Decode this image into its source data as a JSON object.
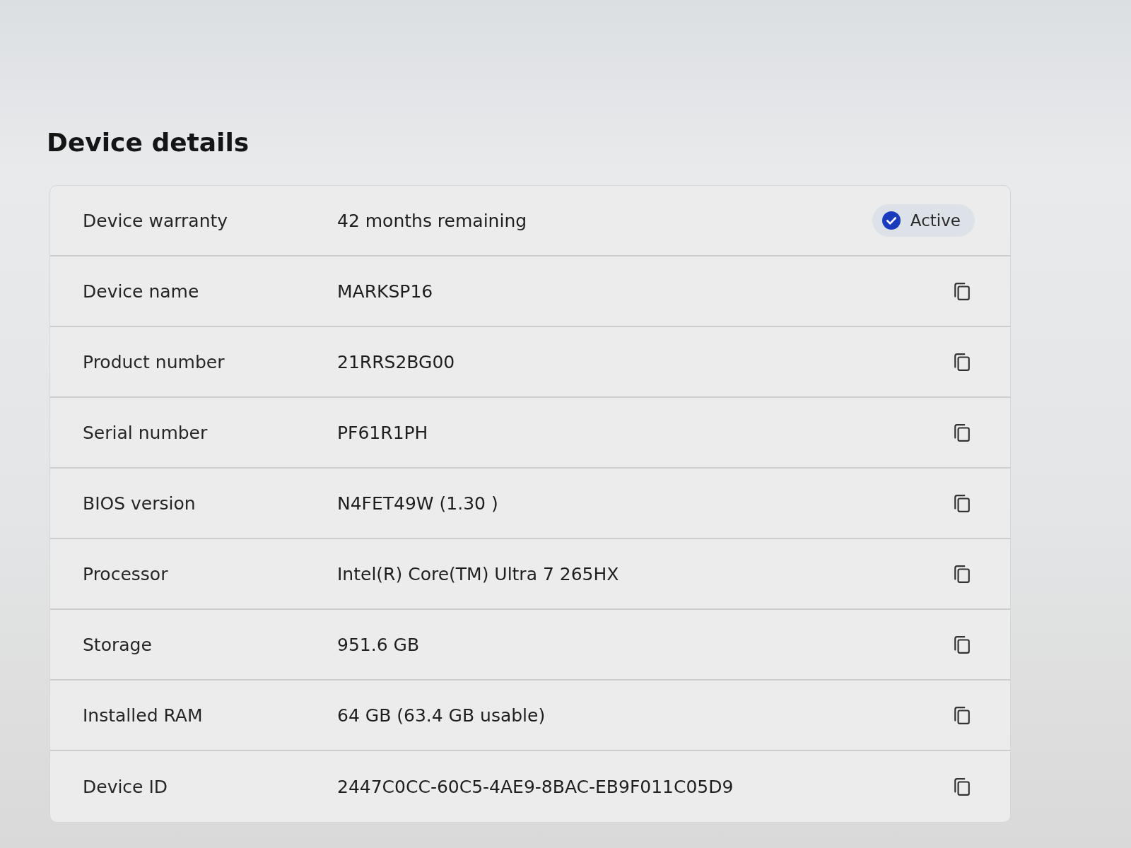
{
  "heading": "Device details",
  "rows": [
    {
      "kind": "status",
      "label": "Device warranty",
      "value": "42 months remaining",
      "badge": "Active"
    },
    {
      "kind": "copy",
      "label": "Device name",
      "value": "MARKSP16"
    },
    {
      "kind": "copy",
      "label": "Product number",
      "value": "21RRS2BG00"
    },
    {
      "kind": "copy",
      "label": "Serial number",
      "value": "PF61R1PH"
    },
    {
      "kind": "copy",
      "label": "BIOS version",
      "value": "N4FET49W (1.30 )"
    },
    {
      "kind": "copy",
      "label": "Processor",
      "value": "Intel(R) Core(TM) Ultra 7 265HX"
    },
    {
      "kind": "copy",
      "label": "Storage",
      "value": "951.6 GB"
    },
    {
      "kind": "copy",
      "label": "Installed RAM",
      "value": "64 GB (63.4 GB usable)"
    },
    {
      "kind": "copy",
      "label": "Device ID",
      "value": "2447C0CC-60C5-4AE9-8BAC-EB9F011C05D9"
    }
  ]
}
